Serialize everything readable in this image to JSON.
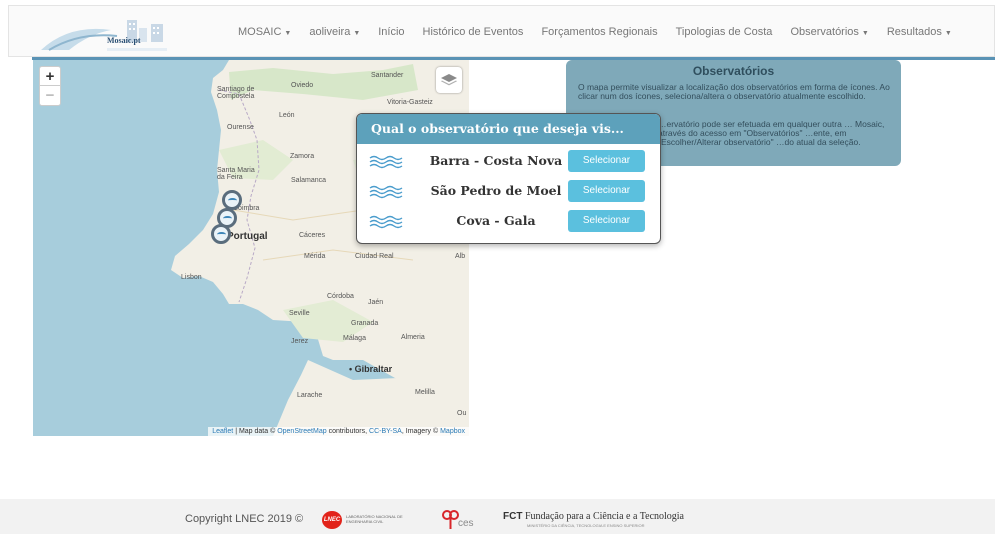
{
  "brand": {
    "logo_text": "Mosaic.pt"
  },
  "nav": {
    "items": [
      {
        "label": "MOSAIC",
        "dropdown": true
      },
      {
        "label": "aoliveira",
        "dropdown": true
      },
      {
        "label": "Início",
        "dropdown": false
      },
      {
        "label": "Histórico de Eventos",
        "dropdown": false
      },
      {
        "label": "Forçamentos Regionais",
        "dropdown": false
      },
      {
        "label": "Tipologias de Costa",
        "dropdown": false
      },
      {
        "label": "Observatórios",
        "dropdown": true
      },
      {
        "label": "Resultados",
        "dropdown": true
      }
    ]
  },
  "map": {
    "zoom_in": "+",
    "zoom_out": "−",
    "labels": {
      "santander": "Santander",
      "oviedo": "Oviedo",
      "santiago": "Santiago de\nCompostela",
      "leon": "León",
      "vitoria": "Vitoria-Gasteiz",
      "ourense": "Ourense",
      "zamora": "Zamora",
      "santa_maria": "Santa Maria\nda Feira",
      "salamanca": "Salamanca",
      "coimbra": "Coimbra",
      "portugal": "Portugal",
      "caceres": "Cáceres",
      "merida": "Mérida",
      "ciudad_real": "Ciudad Real",
      "albacete": "Alb",
      "lisbon": "Lisbon",
      "cordoba": "Córdoba",
      "jaen": "Jaén",
      "seville": "Seville",
      "granada": "Granada",
      "jerez": "Jerez",
      "malaga": "Málaga",
      "almeria": "Almeria",
      "gibraltar": "Gibraltar",
      "larache": "Larache",
      "melilla": "Melilla",
      "ou": "Ou"
    },
    "attribution": {
      "leaflet": "Leaflet",
      "sep1": " | Map data © ",
      "osm": "OpenStreetMap",
      "contributors": " contributors, ",
      "license": "CC-BY-SA",
      "imagery": ", Imagery © ",
      "mapbox": "Mapbox"
    }
  },
  "info_panel": {
    "title": "Observatórios",
    "paragraph1": "O mapa permite visualizar a localização dos observatórios em forma de ícones. Ao clicar num dos ícones, seleciona/altera o observatório atualmente escolhido.",
    "paragraph2": "…ervatório pode ser efetuada em qualquer outra … Mosaic, através do acesso em \"Observatórios\" …ente, em \"Escolher/Alterar observatório\" …do atual da seleção."
  },
  "dialog": {
    "title": "Qual o observatório que deseja vis...",
    "options": [
      {
        "name": "Barra - Costa Nova",
        "button": "Selecionar"
      },
      {
        "name": "São Pedro de Moel",
        "button": "Selecionar"
      },
      {
        "name": "Cova - Gala",
        "button": "Selecionar"
      }
    ]
  },
  "footer": {
    "copyright": "Copyright LNEC 2019 ©",
    "lnec_badge": "LNEC",
    "lnec_name": "LABORATÓRIO NACIONAL DE ENGENHARIA CIVIL",
    "ces_label": "ces",
    "fct_abbr": "FCT",
    "fct_name": " Fundação para a Ciência e a Tecnologia",
    "fct_sub": "MINISTÉRIO DA CIÊNCIA, TECNOLOGIA E ENSINO SUPERIOR"
  },
  "colors": {
    "accent": "#5a93b5",
    "dialog_header": "#5da1bb",
    "select_button": "#5bc0de",
    "info_panel": "#7fa9b9",
    "sea": "#a7cddc",
    "land": "#f2efe6"
  }
}
